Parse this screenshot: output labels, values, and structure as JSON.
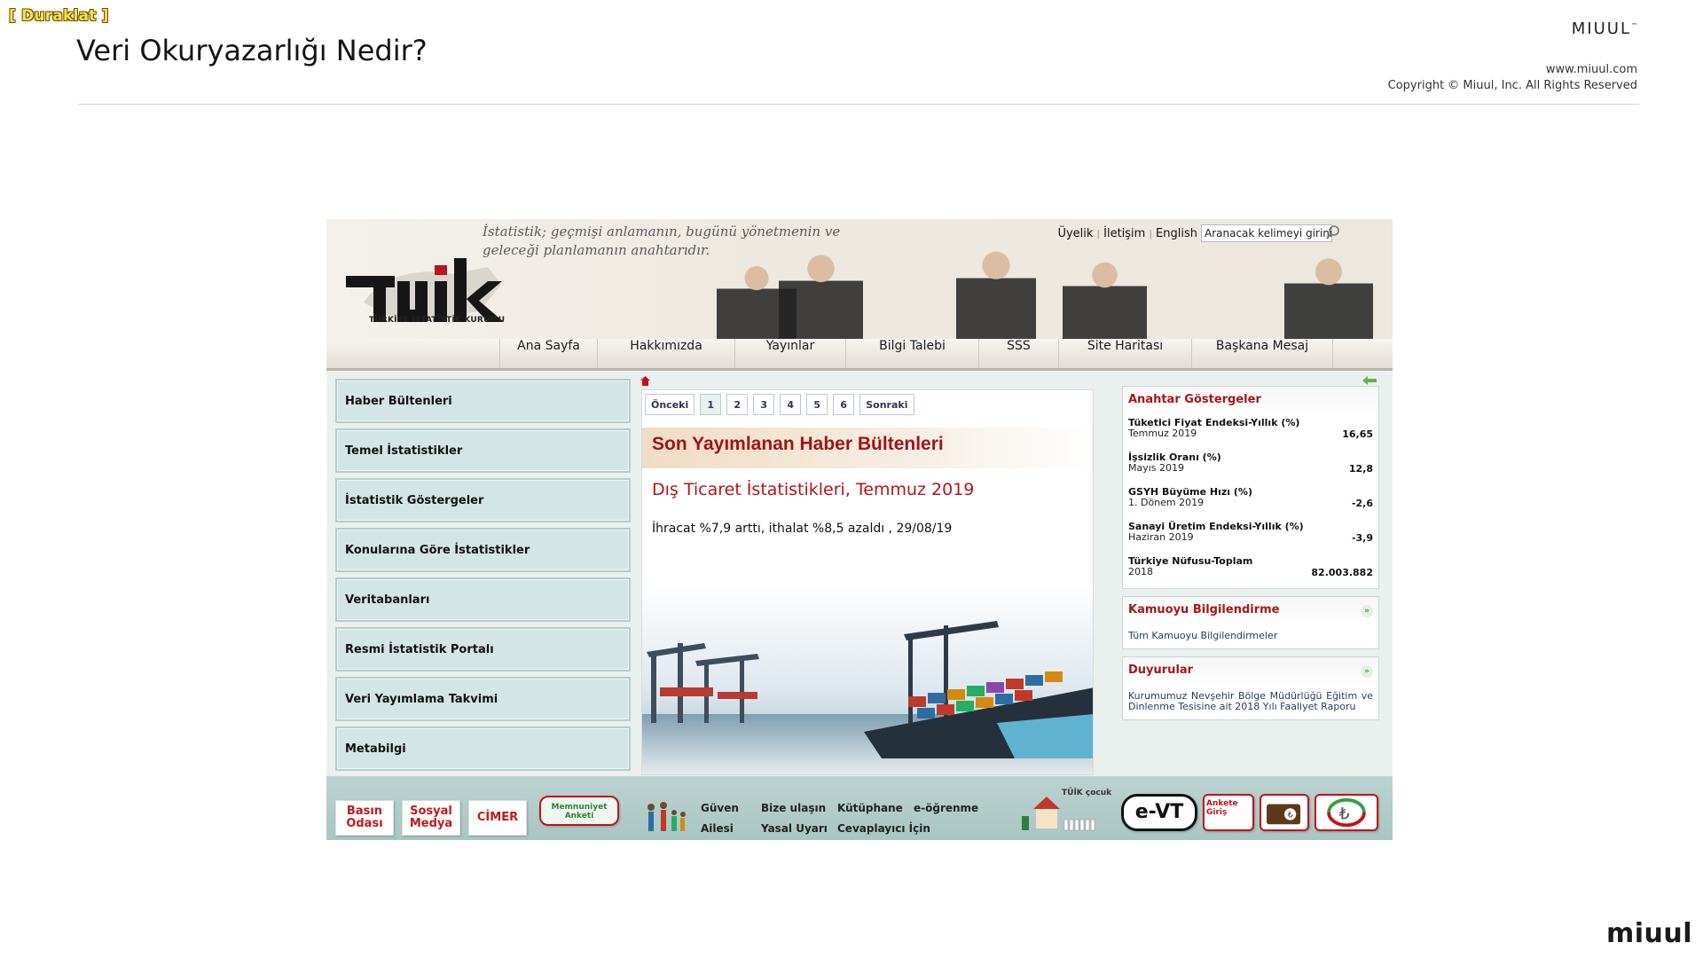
{
  "slide": {
    "pause_label": "[ Duraklat ]",
    "title": "Veri Okuryazarlığı Nedir?",
    "brand": "MIUUL",
    "brand_tm": "™",
    "url": "www.miuul.com",
    "copyright": "Copyright © Miuul, Inc. All Rights Reserved",
    "footer_logo": "miuul"
  },
  "site": {
    "logo_text": "TÜİK",
    "logo_subtitle": "TÜRKİYE İSTATİSTİK KURUMU",
    "slogan": "İstatistik; geçmişi anlamanın, bugünü yönetmenin ve geleceği planlamanın anahtarıdır.",
    "top_links": [
      "Üyelik",
      "İletişim",
      "English"
    ],
    "search_placeholder": "Aranacak kelimeyi girini",
    "nav": [
      "Ana Sayfa",
      "Hakkımızda",
      "Yayınlar",
      "Bilgi Talebi",
      "SSS",
      "Site Haritası",
      "Başkana Mesaj"
    ],
    "left_menu": [
      "Haber Bültenleri",
      "Temel İstatistikler",
      "İstatistik Göstergeler",
      "Konularına Göre İstatistikler",
      "Veritabanları",
      "Resmi İstatistik Portalı",
      "Veri Yayımlama Takvimi",
      "Metabilgi"
    ],
    "pager": [
      "Önceki",
      "1",
      "2",
      "3",
      "4",
      "5",
      "6",
      "Sonraki"
    ],
    "news_heading": "Son Yayımlanan Haber Bültenleri",
    "news_title": "Dış Ticaret İstatistikleri, Temmuz 2019",
    "news_summary": "İhracat %7,9 arttı, ithalat %8,5 azaldı ,  29/08/19",
    "indicators_title": "Anahtar Göstergeler",
    "indicators": [
      {
        "name": "Tüketici Fiyat Endeksi-Yıllık (%)",
        "period": "Temmuz 2019",
        "value": "16,65"
      },
      {
        "name": "İşsizlik Oranı (%)",
        "period": "Mayıs 2019",
        "value": "12,8"
      },
      {
        "name": "GSYH Büyüme Hızı (%)",
        "period": "1. Dönem 2019",
        "value": "-2,6"
      },
      {
        "name": "Sanayi Üretim Endeksi-Yıllık (%)",
        "period": "Haziran 2019",
        "value": "-3,9"
      },
      {
        "name": "Türkiye Nüfusu-Toplam",
        "period": "2018",
        "value": "82.003.882"
      }
    ],
    "public_info_title": "Kamuoyu Bilgilendirme",
    "public_info_link": "Tüm Kamuoyu Bilgilendirmeler",
    "announcements_title": "Duyurular",
    "announcement_text": "Kurumumuz Nevşehir Bölge Müdürlüğü Eğitim ve Dinlenme Tesisine ait 2018 Yılı Faaliyet Raporu",
    "bottom_buttons": [
      "Basın Odası",
      "Sosyal Medya",
      "CİMER",
      "Memnuniyet Anketi"
    ],
    "bottom_links": [
      "Güven",
      "Ailesi",
      "Bize ulaşın",
      "Yasal Uyarı",
      "Kütüphane",
      "Cevaplayıcı İçin",
      "e-öğrenme"
    ],
    "bottom_icons": [
      "TÜİK çocuk",
      "e-VT",
      "Ankete Giriş"
    ]
  },
  "colors": {
    "accent_red": "#a4171d",
    "menu_teal": "#d4e5e5",
    "bottom_teal": "#a9c6c2"
  }
}
